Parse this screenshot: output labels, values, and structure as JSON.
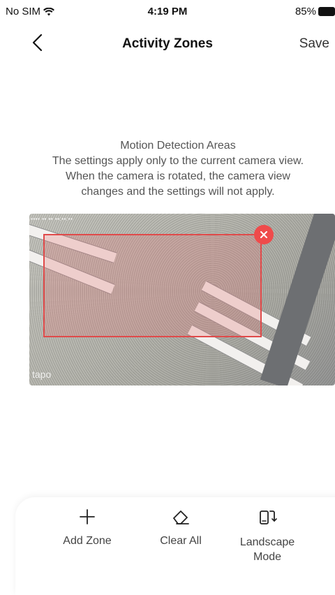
{
  "status_bar": {
    "carrier": "No SIM",
    "time": "4:19 PM",
    "battery": "85%",
    "icons": [
      "wifi-icon",
      "battery-icon"
    ]
  },
  "nav": {
    "title": "Activity Zones",
    "save_label": "Save",
    "back_icon": "chevron-left-icon"
  },
  "description": {
    "heading": "Motion Detection Areas",
    "line1": "The settings apply only to the current camera view.",
    "line2": "When the camera is rotated, the camera view",
    "line3": "changes and the settings will not apply."
  },
  "camera_view": {
    "watermark": "tapo",
    "zone_color": "#e04a4a",
    "close_color": "#ef4b4b"
  },
  "toolbar": {
    "add_zone": "Add Zone",
    "clear_all": "Clear All",
    "landscape_line1": "Landscape",
    "landscape_line2": "Mode"
  }
}
